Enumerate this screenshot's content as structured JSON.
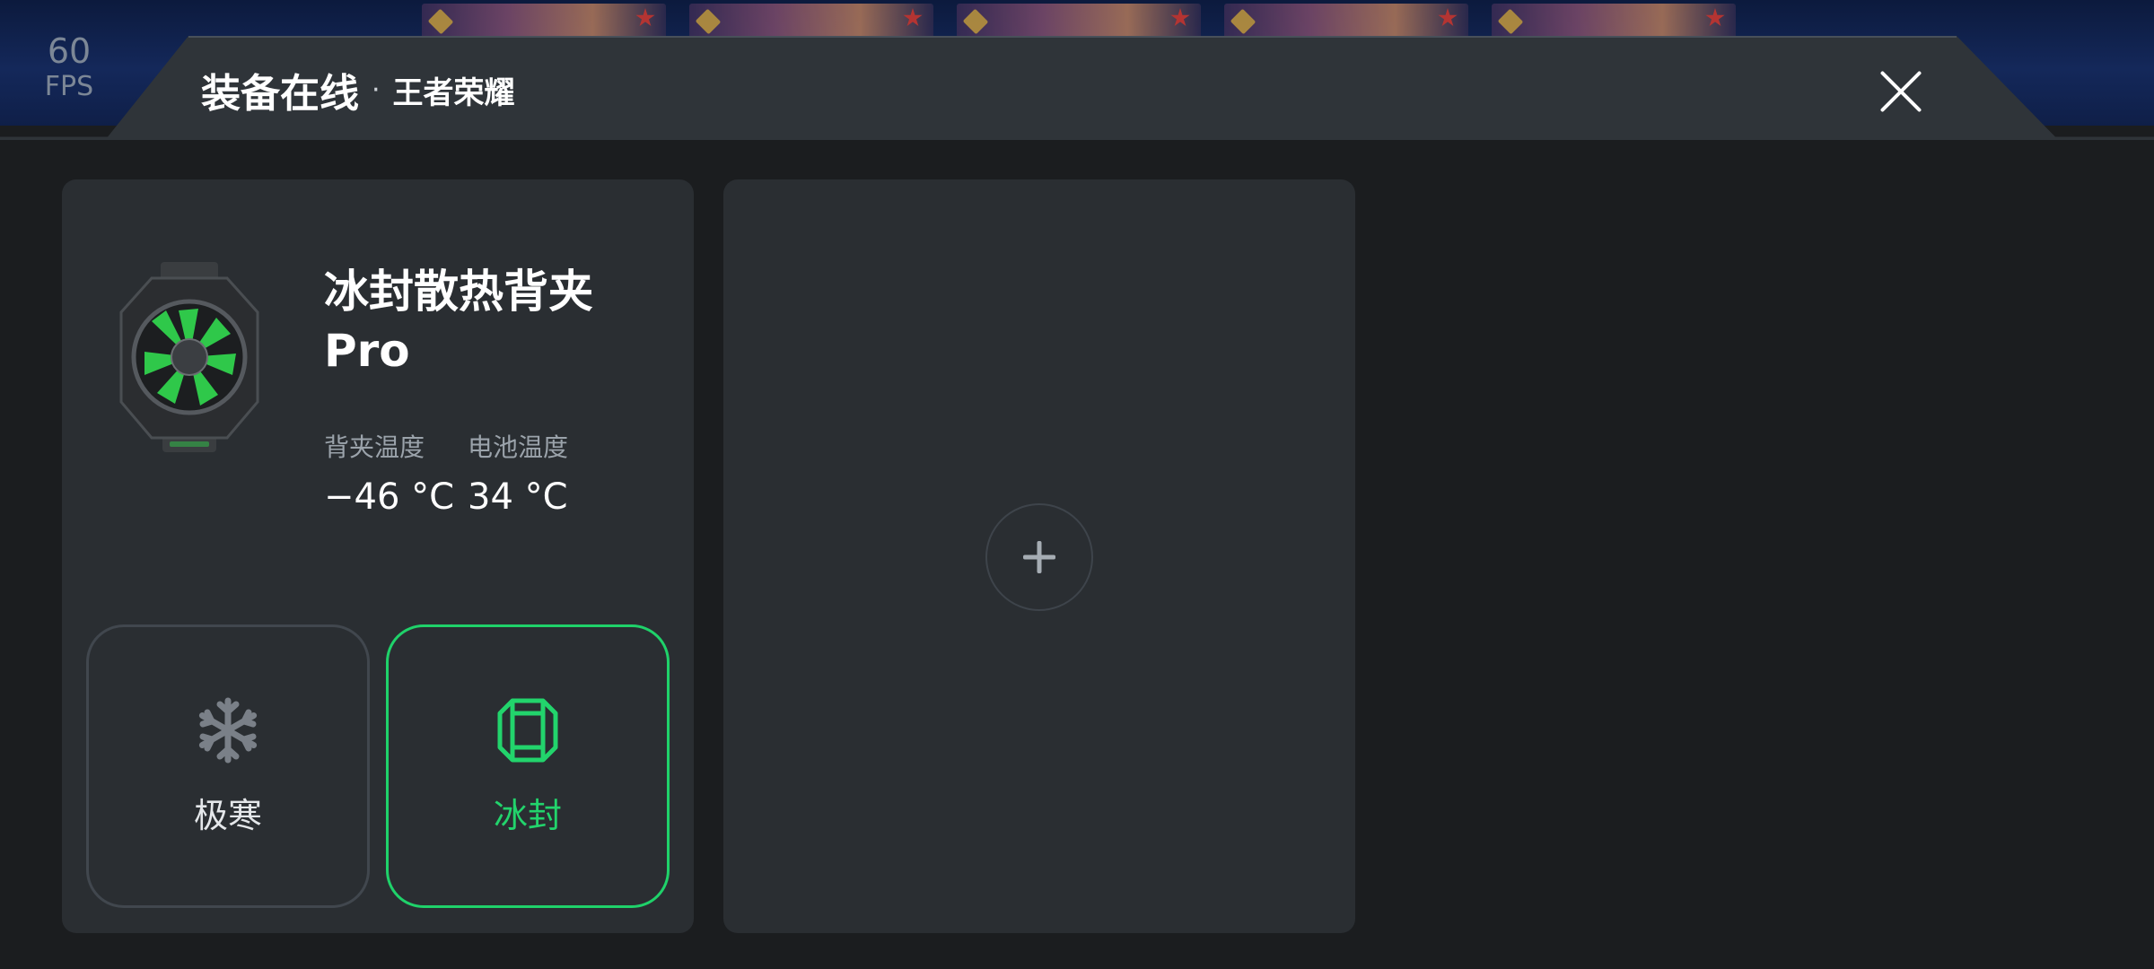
{
  "fps": {
    "value": "60",
    "unit": "FPS"
  },
  "header": {
    "title": "装备在线",
    "separator": "·",
    "game": "王者荣耀"
  },
  "device": {
    "name": "冰封散热背夹 Pro",
    "stats": [
      {
        "label": "背夹温度",
        "value": "−46 °C"
      },
      {
        "label": "电池温度",
        "value": "34 °C"
      }
    ],
    "modes": [
      {
        "label": "极寒",
        "icon": "snowflake-icon",
        "selected": false
      },
      {
        "label": "冰封",
        "icon": "octagon-frame-icon",
        "selected": true
      }
    ]
  },
  "colors": {
    "accent": "#22d46c",
    "background": "#1b1d1f",
    "card": "#2a2e32",
    "header": "#2f3439"
  },
  "icons": {
    "close": "close-icon",
    "add": "plus-icon"
  }
}
